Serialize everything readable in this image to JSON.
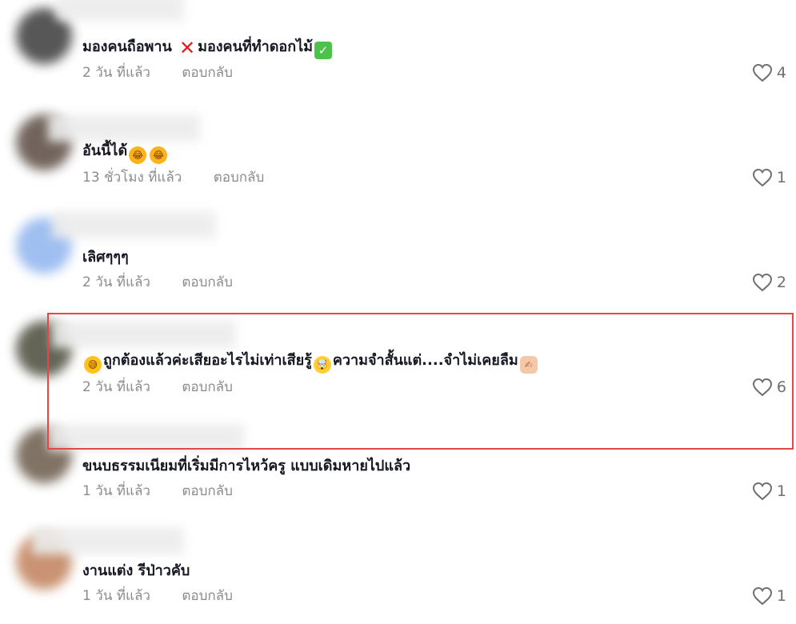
{
  "comments": [
    {
      "text_a": "มองคนถือพาน",
      "emoji_a": "x-mark-emoji",
      "text_b": "มองคนที่ทำดอกไม้",
      "emoji_b": "check-mark-emoji",
      "time": "2 วัน ที่แล้ว",
      "reply": "ตอบกลับ",
      "likes": "4",
      "avatar_color": "#3a3a3a"
    },
    {
      "text": "อันนี้ได้",
      "emojis": [
        "laughing-emoji",
        "laughing-emoji"
      ],
      "time": "13 ชั่วโมง ที่แล้ว",
      "reply": "ตอบกลับ",
      "likes": "1",
      "avatar_color": "#5a4a40"
    },
    {
      "text": "เลิศๆๆๆ",
      "time": "2 วัน ที่แล้ว",
      "reply": "ตอบกลับ",
      "likes": "2",
      "avatar_color": "#8fb4ee"
    },
    {
      "emoji_start": "sweat-smile-emoji",
      "text_a": "ถูกต้องแล้วค่ะเสียอะไรไม่เท่าเสียรู้",
      "emoji_mid": "exploding-head-emoji",
      "text_b": "ความจำสั้นแต่....จำไม่เคยลืม",
      "emoji_end": "writing-hand-emoji",
      "time": "2 วัน ที่แล้ว",
      "reply": "ตอบกลับ",
      "likes": "6",
      "avatar_color": "#4a4a3a"
    },
    {
      "text": "ขนบธรรมเนียมที่เริ่มมีการไหว้ครู แบบเดิมหายไปแล้ว",
      "time": "1 วัน ที่แล้ว",
      "reply": "ตอบกลับ",
      "likes": "1",
      "avatar_color": "#6a5a4a"
    },
    {
      "text": "งานแต่ง รีป่าวคับ",
      "time": "1 วัน ที่แล้ว",
      "reply": "ตอบกลับ",
      "likes": "1",
      "avatar_color": "#c0805a"
    }
  ],
  "colors": {
    "highlight_border": "#e0484a",
    "meta_text": "#8a8b91",
    "comment_text": "#161823"
  }
}
